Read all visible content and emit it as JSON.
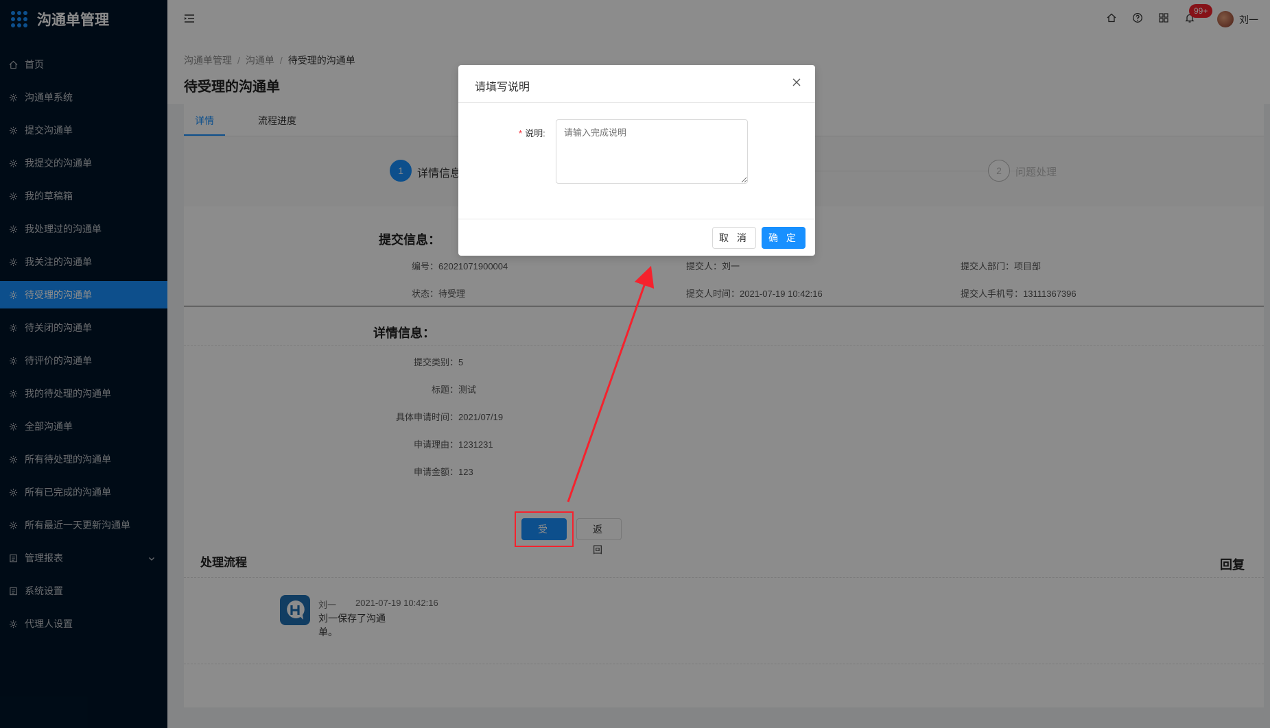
{
  "app": {
    "title": "沟通单管理"
  },
  "sidebar": {
    "items": [
      {
        "label": "首页",
        "icon": "home-icon"
      },
      {
        "label": "沟通单系统",
        "icon": "gear-icon"
      },
      {
        "label": "提交沟通单",
        "icon": "gear-icon"
      },
      {
        "label": "我提交的沟通单",
        "icon": "gear-icon"
      },
      {
        "label": "我的草稿箱",
        "icon": "gear-icon"
      },
      {
        "label": "我处理过的沟通单",
        "icon": "gear-icon"
      },
      {
        "label": "我关注的沟通单",
        "icon": "gear-icon"
      },
      {
        "label": "待受理的沟通单",
        "icon": "gear-icon",
        "active": true
      },
      {
        "label": "待关闭的沟通单",
        "icon": "gear-icon"
      },
      {
        "label": "待评价的沟通单",
        "icon": "gear-icon"
      },
      {
        "label": "我的待处理的沟通单",
        "icon": "gear-icon"
      },
      {
        "label": "全部沟通单",
        "icon": "gear-icon"
      },
      {
        "label": "所有待处理的沟通单",
        "icon": "gear-icon"
      },
      {
        "label": "所有已完成的沟通单",
        "icon": "gear-icon"
      },
      {
        "label": "所有最近一天更新沟通单",
        "icon": "gear-icon"
      },
      {
        "label": "管理报表",
        "icon": "report-icon",
        "has_children": true
      },
      {
        "label": "系统设置",
        "icon": "report-icon"
      },
      {
        "label": "代理人设置",
        "icon": "gear-icon"
      }
    ]
  },
  "header": {
    "notification_count": "99+",
    "username": "刘一"
  },
  "breadcrumb": [
    "沟通单管理",
    "沟通单",
    "待受理的沟通单"
  ],
  "page_title": "待受理的沟通单",
  "tabs": [
    "详情",
    "流程进度"
  ],
  "steps": [
    {
      "num": "1",
      "label": "详情信息"
    },
    {
      "num": "2",
      "label": "问题处理"
    }
  ],
  "submit_info": {
    "title": "提交信息：",
    "fields": [
      {
        "label": "编号：",
        "value": "62021071900004"
      },
      {
        "label": "提交人：",
        "value": "刘一"
      },
      {
        "label": "提交人部门：",
        "value": "项目部"
      },
      {
        "label": "状态：",
        "value": "待受理"
      },
      {
        "label": "提交人时间：",
        "value": "2021-07-19 10:42:16"
      },
      {
        "label": "提交人手机号：",
        "value": "13111367396"
      }
    ]
  },
  "detail_info": {
    "title": "详情信息：",
    "fields": [
      {
        "label": "提交类别：",
        "value": "5"
      },
      {
        "label": "标题：",
        "value": "测试"
      },
      {
        "label": "具体申请时间：",
        "value": "2021/07/19"
      },
      {
        "label": "申请理由：",
        "value": "1231231"
      },
      {
        "label": "申请金额：",
        "value": "123"
      }
    ]
  },
  "actions": {
    "accept": "受 理",
    "back": "返 回"
  },
  "process": {
    "title": "处理流程",
    "reply": "回复",
    "entries": [
      {
        "user": "刘一",
        "time": "2021-07-19 10:42:16",
        "text_line1": "刘一保存了沟通",
        "text_line2": "单。"
      }
    ]
  },
  "modal": {
    "title": "请填写说明",
    "field_label": "说明:",
    "required_mark": "*",
    "placeholder": "请输入完成说明",
    "value": "",
    "cancel": "取 消",
    "confirm": "确 定"
  },
  "colors": {
    "primary": "#1890ff",
    "sidebar": "#001529",
    "annotation": "#f5222d"
  }
}
